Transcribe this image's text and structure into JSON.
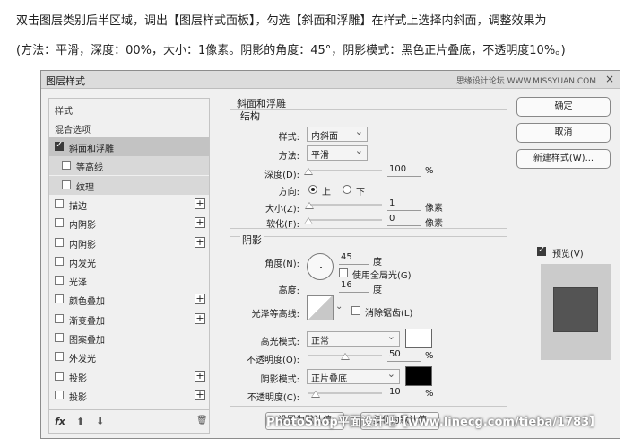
{
  "tutorial": {
    "line1": "双击图层类别后半区域，调出【图层样式面板】，勾选【斜面和浮雕】在样式上选择内斜面，调整效果为",
    "line2": "(方法：平滑，深度：00%，大小：1像素。阴影的角度：45°，阴影模式：黑色正片叠底，不透明度10%。)"
  },
  "dialog": {
    "title": "图层样式",
    "watermark": "思缘设计论坛 WWW.MISSYUAN.COM",
    "close": "×"
  },
  "style_list": {
    "header1": "样式",
    "header2": "混合选项",
    "items": [
      {
        "label": "斜面和浮雕",
        "checked": true,
        "plus": false
      },
      {
        "label": "等高线",
        "checked": false,
        "plus": false
      },
      {
        "label": "纹理",
        "checked": false,
        "plus": false
      },
      {
        "label": "描边",
        "checked": false,
        "plus": true
      },
      {
        "label": "内阴影",
        "checked": false,
        "plus": true
      },
      {
        "label": "内阴影",
        "checked": false,
        "plus": true
      },
      {
        "label": "内发光",
        "checked": false,
        "plus": false
      },
      {
        "label": "光泽",
        "checked": false,
        "plus": false
      },
      {
        "label": "颜色叠加",
        "checked": false,
        "plus": true
      },
      {
        "label": "渐变叠加",
        "checked": false,
        "plus": true
      },
      {
        "label": "图案叠加",
        "checked": false,
        "plus": false
      },
      {
        "label": "外发光",
        "checked": false,
        "plus": false
      },
      {
        "label": "投影",
        "checked": false,
        "plus": true
      },
      {
        "label": "投影",
        "checked": false,
        "plus": true
      }
    ],
    "fx": "fx",
    "up": "⬆",
    "down": "⬇",
    "trash": "🗑"
  },
  "bevel": {
    "group_title": "斜面和浮雕",
    "structure_title": "结构",
    "style_label": "样式:",
    "style_value": "内斜面",
    "method_label": "方法:",
    "method_value": "平滑",
    "depth_label": "深度(D):",
    "depth_value": "100",
    "depth_unit": "%",
    "depth_pct": 0.0,
    "direction_label": "方向:",
    "dir_up": "上",
    "dir_down": "下",
    "size_label": "大小(Z):",
    "size_value": "1",
    "size_unit": "像素",
    "size_pct": 0.01,
    "soften_label": "软化(F):",
    "soften_value": "0",
    "soften_unit": "像素",
    "soften_pct": 0.0
  },
  "shading": {
    "title": "阴影",
    "angle_label": "角度(N):",
    "angle_value": "45",
    "angle_unit": "度",
    "global_light": "使用全局光(G)",
    "altitude_label": "高度:",
    "altitude_value": "16",
    "altitude_unit": "度",
    "gloss_label": "光泽等高线:",
    "antialias": "消除锯齿(L)",
    "highlight_label": "高光模式:",
    "highlight_value": "正常",
    "highlight_color": "#ffffff",
    "hl_opacity_label": "不透明度(O):",
    "hl_opacity_value": "50",
    "hl_opacity_unit": "%",
    "hl_opacity_pct": 0.5,
    "shadow_label": "阴影模式:",
    "shadow_value": "正片叠底",
    "shadow_color": "#000000",
    "sh_opacity_label": "不透明度(C):",
    "sh_opacity_value": "10",
    "sh_opacity_unit": "%",
    "sh_opacity_pct": 0.1,
    "set_default": "设置为默认值",
    "reset_default": "复位为默认值"
  },
  "actions": {
    "ok": "确定",
    "cancel": "取消",
    "new_style": "新建样式(W)...",
    "preview": "预览(V)"
  },
  "bottom_watermark": "PhotoShop平面设计吧【www.linecg.com/tieba/1783】"
}
